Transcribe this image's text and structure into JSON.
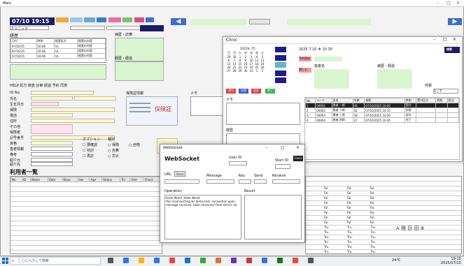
{
  "main": {
    "title": "Main",
    "date": "07/10 19:15",
    "clinic_name": "クリニック",
    "history_heading": "経歴",
    "history_cols": [
      "日付",
      "時刻",
      "経歴区分",
      "経歴の内容"
    ],
    "history_rows": [
      [
        "07/10/15",
        "16:06",
        "VL",
        "経歴の内容"
      ],
      [
        "07/10/15",
        "16:06",
        "VL",
        "経歴の内容"
      ],
      [
        "07/10/15",
        "16:06",
        "VL",
        "経歴の内容"
      ]
    ],
    "memo_label": "病歴・診療",
    "comment_label": "経歴・経過",
    "menu_bar": "HELP  処方  検査  診断  経過  予約  同意",
    "patient_labels": [
      "ID No.",
      "氏名",
      "生年月日",
      "保険",
      "電話",
      "住所",
      "その他",
      "保険者",
      "記号番号",
      "資格",
      "患者情報",
      "備考",
      "紹介元",
      "紹介先"
    ],
    "insurance_card_label": "保険証情報",
    "insurance_card_text": "保険証",
    "note_label": "メモ",
    "options_label": "オプション",
    "options": [
      "要確認",
      "初診",
      "再診",
      "自費",
      "電話"
    ],
    "type_label": "種別",
    "types": [
      "保険",
      "自費",
      "労災",
      "自賠"
    ],
    "list_title": "利用者一覧",
    "list_cols": [
      "No.",
      "ID",
      "Name",
      "Date",
      "Kana",
      "Sex",
      "Age",
      "Status",
      "Tel",
      "Visit",
      "Check",
      "A",
      "B",
      "C",
      "D"
    ],
    "list_right_values": [
      "Fal.",
      "Fal.",
      "Tru.",
      "Tru."
    ],
    "zoom_toolbar": "A 検 目 田 ⊕"
  },
  "clinic": {
    "title": "Clinic",
    "calendar_title": "2025年 7月",
    "calendar_days": [
      "日",
      "月",
      "火",
      "水",
      "木",
      "金",
      "土"
    ],
    "calendar_rows": [
      [
        "29",
        "30",
        "1",
        "2",
        "3",
        "4",
        "5"
      ],
      [
        "6",
        "7",
        "8",
        "9",
        "10",
        "11",
        "12"
      ],
      [
        "13",
        "14",
        "15",
        "16",
        "17",
        "18",
        "19"
      ],
      [
        "20",
        "21",
        "22",
        "23",
        "24",
        "25",
        "26"
      ],
      [
        "27",
        "28",
        "29",
        "30",
        "31",
        "1",
        "2"
      ]
    ],
    "date_fields": [
      "2025",
      "7",
      "10",
      "木",
      "10",
      "30"
    ],
    "reserve_button": "予約登録",
    "search_button": "検索",
    "close_button": "閉じる",
    "patient_label": "患者名",
    "memo_label": "病歴・経過",
    "note_label": "記録・連絡",
    "tabs": [
      "受付",
      "診察",
      "会計",
      "完了"
    ],
    "count_label": "件数",
    "count_value": "1 / 7",
    "table_cols": [
      "No.",
      "コード",
      "氏名",
      "年齢",
      "来院",
      "時刻",
      "受付区分",
      "状態",
      "担当"
    ],
    "table_rows": [
      [
        "1",
        "00001",
        "患者 一郎",
        "45",
        "07/10/2025 10:00",
        "受付",
        "",
        ""
      ],
      [
        "2",
        "00002",
        "患者 二郎",
        "32",
        "07/10/2025 10:15",
        "診察",
        "",
        ""
      ],
      [
        "3",
        "00003",
        "患者 三郎",
        "58",
        "07/10/2025 10:30",
        "会計",
        "",
        ""
      ],
      [
        "4",
        "00004",
        "患者 四郎",
        "27",
        "07/10/2025 10:45",
        "完了",
        "",
        ""
      ]
    ],
    "left_note_label": "メモ",
    "left_history_label": "経歴"
  },
  "websocket": {
    "title": "WebSocket",
    "heading": "WebSocket",
    "start_label": "Start ID",
    "send_button": "Send",
    "clear_button": "Clear",
    "url_label": "URL",
    "message_label": "Message",
    "userid_label": "User ID",
    "receive_label": "Receive",
    "field_labels": [
      "Key",
      "Send",
      "Receive",
      "From ID",
      "Key 2"
    ],
    "log_label": "Operation",
    "result_label": "Result",
    "log_text": "Hello World. Hello World.",
    "log_text2": "this reconnecting ws demo test. connection open. message received. hello reconnect from server. ok."
  },
  "taskbar": {
    "search_placeholder": "ここに入力して検索",
    "weather": "24°C",
    "time": "19:15",
    "date": "2025/07/10"
  }
}
